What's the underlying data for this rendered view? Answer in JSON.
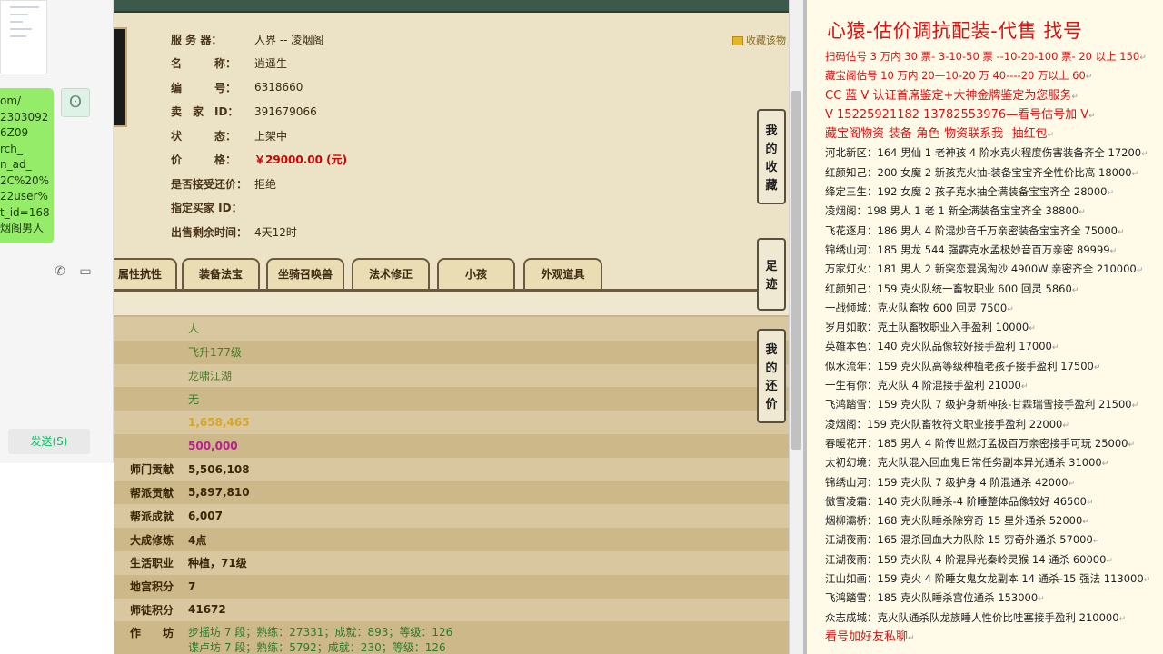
{
  "chat": {
    "bubble_lines": [
      "om/",
      "2303092",
      "6Z09",
      "rch_",
      "n_ad_",
      "2C%20%",
      "22user%",
      "t_id=168",
      "烟阁男人"
    ],
    "send_label": "发送(S)"
  },
  "game": {
    "favorite_label": "收藏该物",
    "info": [
      {
        "label": "服 务 器：",
        "value": "人界 -- 凌烟阁"
      },
      {
        "label": "名　　　称：",
        "value": "逍遥生"
      },
      {
        "label": "编　　　号：",
        "value": "6318660"
      },
      {
        "label": "卖　家　ID：",
        "value": "391679066"
      },
      {
        "label": "状　　　态：",
        "value": "上架中"
      },
      {
        "label": "价　　　格：",
        "value": "￥29000.00 (元)",
        "price": true
      },
      {
        "label": "是否接受还价：",
        "value": "拒绝"
      },
      {
        "label": "指定买家 ID：",
        "value": ""
      },
      {
        "label": "出售剩余时间：",
        "value": "4天12时"
      }
    ],
    "tabs": [
      "属性抗性",
      "装备法宝",
      "坐骑召唤兽",
      "法术修正",
      "小孩",
      "外观道具"
    ],
    "side_buttons": [
      "我的收藏",
      "足迹",
      "我的还价"
    ],
    "rows": [
      {
        "label": "",
        "value": "人",
        "style": "green"
      },
      {
        "label": "",
        "value": "飞升177级",
        "style": "green"
      },
      {
        "label": "",
        "value": "龙啸江湖",
        "style": "green"
      },
      {
        "label": "",
        "value": "无",
        "style": "green2"
      },
      {
        "label": "",
        "value": "1,658,465",
        "style": "gold"
      },
      {
        "label": "",
        "value": "500,000",
        "style": "mag"
      },
      {
        "label": "师门贡献",
        "value": "5,506,108",
        "style": ""
      },
      {
        "label": "帮派贡献",
        "value": "5,897,810",
        "style": ""
      },
      {
        "label": "帮派成就",
        "value": "6,007",
        "style": ""
      },
      {
        "label": "大成修炼",
        "value": "4点",
        "style": ""
      },
      {
        "label": "生活职业",
        "value": "种植，71级",
        "style": ""
      },
      {
        "label": "地宫积分",
        "value": "7",
        "style": ""
      },
      {
        "label": "师徒积分",
        "value": "41672",
        "style": ""
      }
    ],
    "craft": {
      "label": "作　　坊",
      "line1": "步摇坊 7 段；熟练：27331；成就：893；等级：126",
      "line2": "谍卢坊 7 段；熟练：5792；成就：230；等级：126"
    }
  },
  "notes": {
    "title": "心猿-估价调抗配装-代售 找号",
    "lines": [
      {
        "text": "扫码估号 3 万内 30 票- 3-10-50 票  --10-20-100 票- 20 以上 150",
        "red": true
      },
      {
        "text": "藏宝阁估号 10 万内 20—10-20 万 40----20 万以上 60",
        "red": true
      },
      {
        "text": "CC 蓝 V 认证首席鉴定+大神金牌鉴定为您服务",
        "red": true,
        "big": true
      },
      {
        "text": "V 15225921182      13782553976—看号估号加 V",
        "red": true,
        "big": true
      },
      {
        "text": "藏宝阁物资-装备-角色-物资联系我--抽红包",
        "red": true,
        "big": true
      },
      {
        "text": "河北新区：164 男仙 1 老神孩 4 阶水克火程度伤害装备齐全 17200",
        "red": false
      },
      {
        "text": "红颜知己：200 女魔 2 新孩克火抽-装备宝宝齐全性价比高 18000",
        "red": false
      },
      {
        "text": "绛定三生：192 女魔 2 孩子克水抽全满装备宝宝齐全 28000",
        "red": false
      },
      {
        "text": "凌烟阁：198 男人 1 老 1 新全满装备宝宝齐全 38800",
        "red": false
      },
      {
        "text": "飞花逐月：186 男人 4 阶混炒音千万亲密装备宝宝齐全 75000",
        "red": false
      },
      {
        "text": "锦绣山河：185 男龙 544 强霹克水孟极妙音百万亲密 89999",
        "red": false
      },
      {
        "text": "万家灯火：181 男人 2 新突恋混涡淘沙 4900W 亲密齐全 210000",
        "red": false
      },
      {
        "text": "红颜知己：159 克火队统一畜牧职业 600 回灵 5860",
        "red": false
      },
      {
        "text": "一战倾城：克火队畜牧 600 回灵 7500",
        "red": false
      },
      {
        "text": "岁月如歌：克土队畜牧职业入手盈利 10000",
        "red": false
      },
      {
        "text": "英雄本色：140 克火队品像较好接手盈利 17000",
        "red": false
      },
      {
        "text": "似水流年：159 克火队高等级种植老孩子接手盈利 17500",
        "red": false
      },
      {
        "text": "一生有你：克火队 4 阶混接手盈利 21000",
        "red": false
      },
      {
        "text": "飞鸿踏雪：159 克火队 7 级护身新神孩-甘霖瑞雪接手盈利 21500",
        "red": false
      },
      {
        "text": "凌烟阁：159 克火队畜牧符文职业接手盈利 22000",
        "red": false
      },
      {
        "text": "春暖花开：185 男人 4 阶传世燃灯孟极百万亲密接手可玩 25000",
        "red": false
      },
      {
        "text": "太初幻境：克火队混入回血鬼日常任务副本异光通杀 31000",
        "red": false
      },
      {
        "text": "锦绣山河：159 克火队 7 级护身 4 阶混通杀 42000",
        "red": false
      },
      {
        "text": "傲雪凌霜：140 克火队睡杀-4 阶睡整体品像较好 46500",
        "red": false
      },
      {
        "text": "烟柳灞桥：168 克火队睡杀除穷奇 15 星外通杀 52000",
        "red": false
      },
      {
        "text": "江湖夜雨：165 混杀回血大力队除 15 穷奇外通杀 57000",
        "red": false
      },
      {
        "text": "江湖夜雨：159 克火队 4 阶混异光秦岭灵猴 14 通杀 60000",
        "red": false
      },
      {
        "text": "江山如画：159 克火 4 阶睡女鬼女龙副本 14 通杀-15 强法 113000",
        "red": false
      },
      {
        "text": "飞鸿踏雪：185 克火队睡杀宫位通杀 153000",
        "red": false
      },
      {
        "text": "众志成城：克火队通杀队龙族睡人性价比哇塞接手盈利 210000",
        "red": false
      },
      {
        "text": "看号加好友私聊",
        "red": true,
        "big": true
      }
    ]
  }
}
